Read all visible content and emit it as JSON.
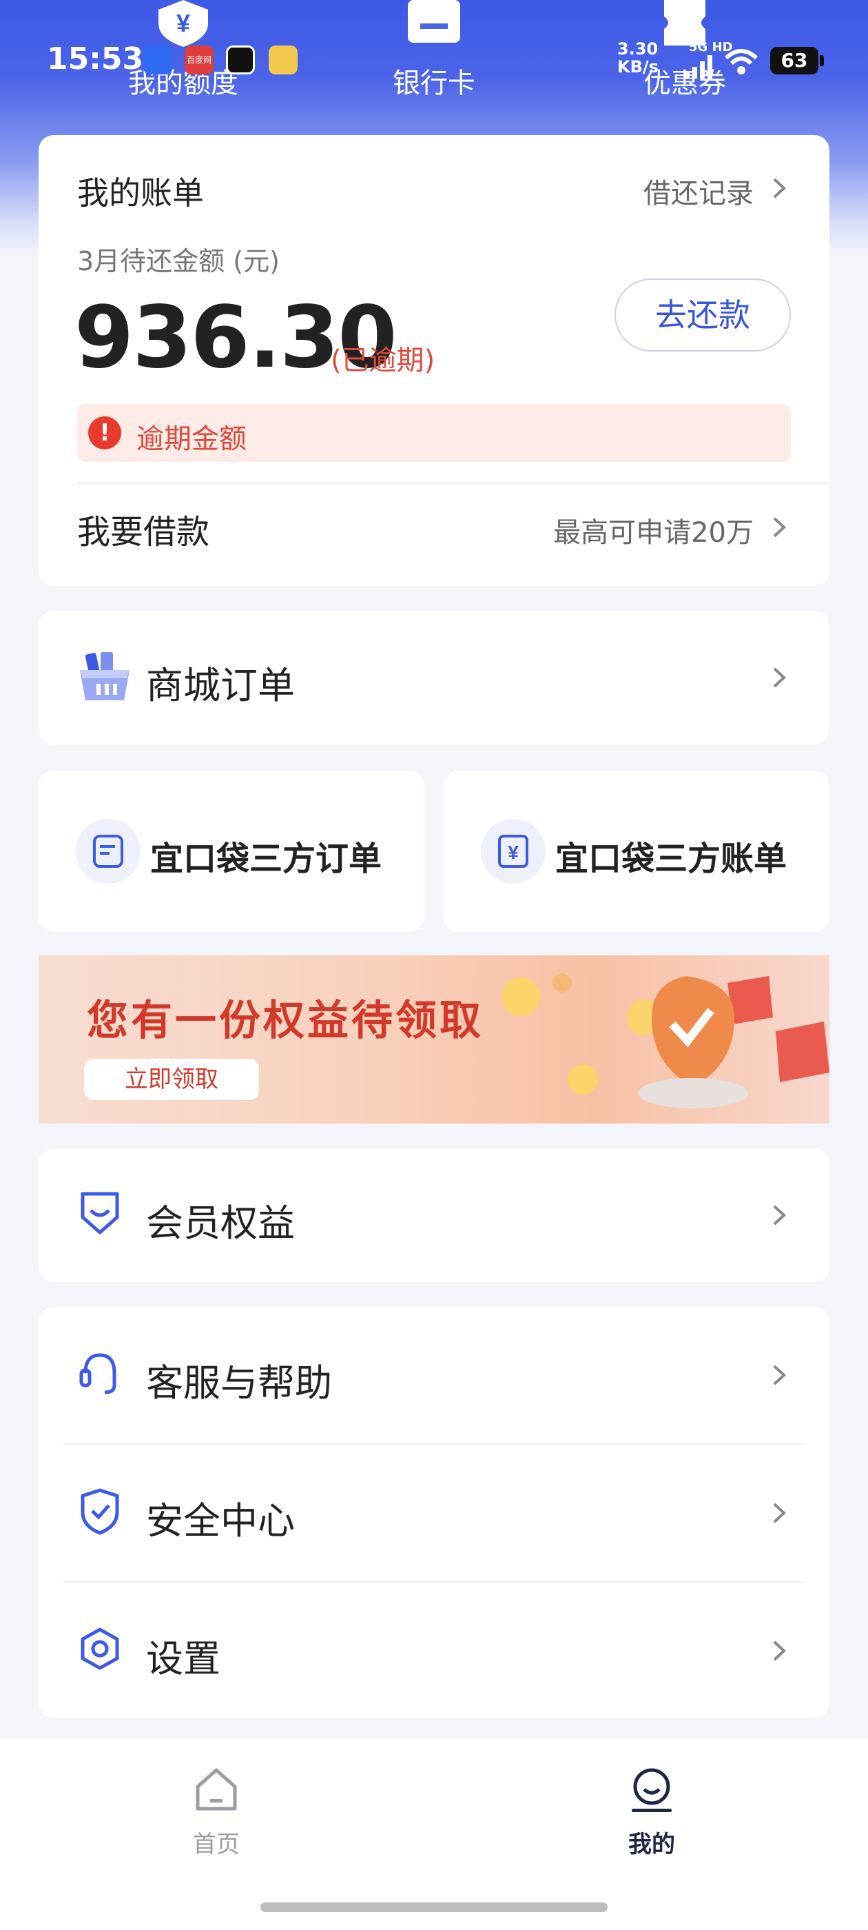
{
  "status_bar": {
    "time": "15:53",
    "app2_text": "百度网",
    "net_speed": "3.30\nKB/s",
    "net_type": "5G HD",
    "battery": "63"
  },
  "top_nav": [
    {
      "label": "我的额度",
      "icon": "yen-shield-icon"
    },
    {
      "label": "银行卡",
      "icon": "card-icon"
    },
    {
      "label": "优惠券",
      "icon": "ticket-icon"
    }
  ],
  "bill": {
    "title": "我的账单",
    "record_link": "借还记录",
    "due_label": "3月待还金额 (元)",
    "amount": "936.30",
    "overdue_tag": "(已逾期)",
    "repay_button": "去还款",
    "overdue_notice": "逾期金额",
    "overdue_icon": "!",
    "borrow_title": "我要借款",
    "borrow_sub": "最高可申请20万"
  },
  "mall_order": {
    "label": "商城订单"
  },
  "third_party": [
    {
      "label": "宜口袋三方订单"
    },
    {
      "label": "宜口袋三方账单"
    }
  ],
  "banner": {
    "title": "您有一份权益待领取",
    "button": "立即领取"
  },
  "member": {
    "label": "会员权益"
  },
  "menu": [
    {
      "label": "客服与帮助"
    },
    {
      "label": "安全中心"
    },
    {
      "label": "设置"
    }
  ],
  "bottom_tabs": [
    {
      "label": "首页",
      "active": false
    },
    {
      "label": "我的",
      "active": true
    }
  ],
  "colors": {
    "brand_blue": "#3d5ae6",
    "overdue_red": "#e34a3c",
    "tab_active": "#1f2545",
    "tab_inactive": "#9a9ca8"
  }
}
